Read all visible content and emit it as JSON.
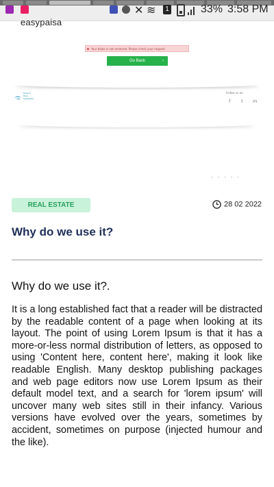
{
  "status_bar": {
    "battery": "33%",
    "time": "3:58 PM",
    "notification_count": "1"
  },
  "header": {
    "logo": "easypaisa"
  },
  "error_banner": {
    "message": "Your bloke is not rendered. Please check your request.",
    "button_label": "Go Back",
    "button_icon": "chevron-right-icon"
  },
  "footer_preview": {
    "brand_lines": [
      "Fintech",
      "Pays",
      "easypaisa"
    ],
    "follow_label": "Follow us on",
    "social": [
      "f",
      "t",
      "in"
    ]
  },
  "article": {
    "category": "REAL ESTATE",
    "date": "28 02 2022",
    "title": "Why do we use it?",
    "subtitle": "Why do we use it?.",
    "body": "It is a long established fact that a reader will be distracted by the readable content of a page when looking at its layout. The point of using Lorem Ipsum is that it has a more-or-less normal distribution of letters, as opposed to using 'Content here, content here', making it look like readable English. Many desktop publishing packages and web page editors now use Lorem Ipsum as their default model text, and a search for 'lorem ipsum' will uncover many web sites still in their infancy. Various versions have evolved over the years, sometimes by accident, sometimes on purpose (injected humour and the like)."
  },
  "colors": {
    "accent_green": "#26b24a",
    "badge_bg": "#c9f2db",
    "badge_text": "#27a05a",
    "title_navy": "#1f2f5a"
  }
}
